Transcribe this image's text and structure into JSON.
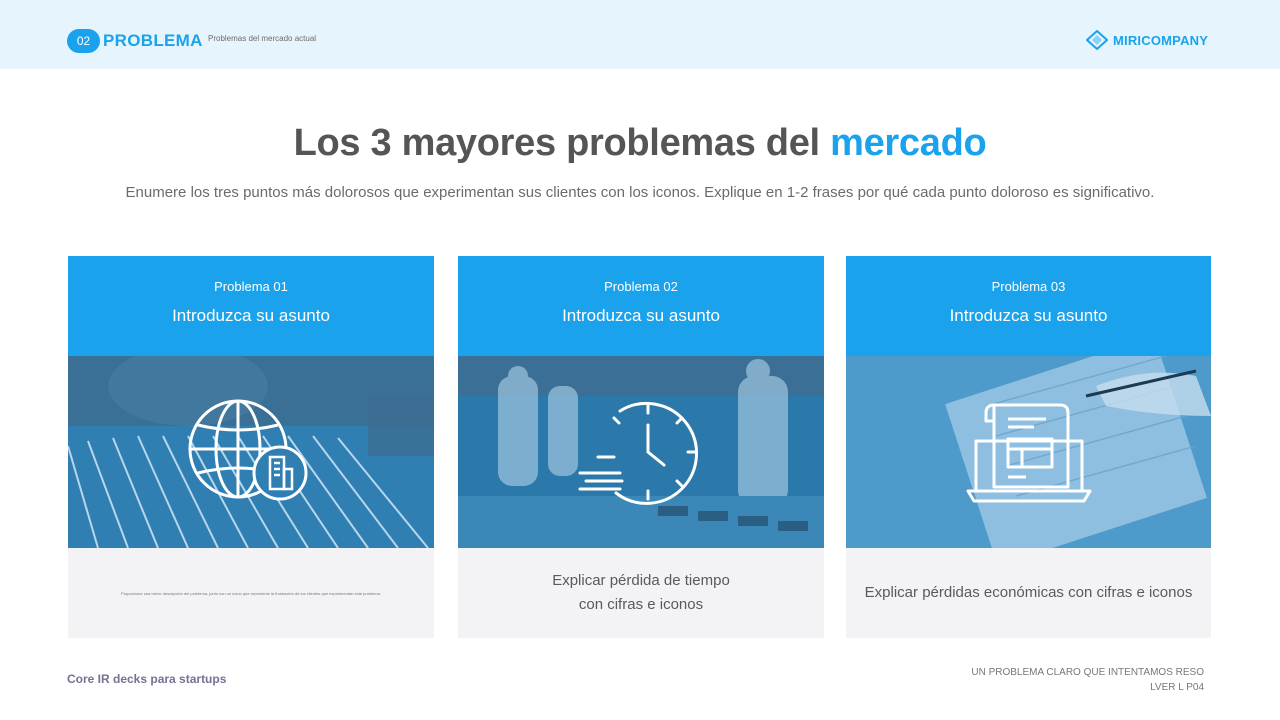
{
  "header": {
    "badge": "02",
    "section_title": "PROBLEMA",
    "section_subtitle": "Problemas del mercado actual",
    "brand": "MIRICOMPANY"
  },
  "main": {
    "title_part1": "Los 3 mayores problemas del",
    "title_accent": "mercado",
    "subtitle": "Enumere los tres puntos más dolorosos que experimentan sus clientes con los iconos. Explique en 1-2 frases por qué cada punto doloroso es significativo."
  },
  "cards": [
    {
      "number": "Problema 01",
      "title": "Introduzca su asunto",
      "icon": "globe-building-icon",
      "description": "Proporcione una breve descripción del problema, junto con un icono que represente la frustración de los clientes que experimentan este problema."
    },
    {
      "number": "Problema 02",
      "title": "Introduzca su asunto",
      "icon": "fast-clock-icon",
      "description_line1": "Explicar pérdida de tiempo",
      "description_line2": "con cifras e iconos"
    },
    {
      "number": "Problema 03",
      "title": "Introduzca su asunto",
      "icon": "document-laptop-icon",
      "description": "Explicar pérdidas económicas con cifras e iconos"
    }
  ],
  "footer": {
    "left": "Core IR decks para startups",
    "right_line1": "UN PROBLEMA CLARO QUE INTENTAMOS RESO",
    "right_line2": "LVER L P04"
  },
  "colors": {
    "accent": "#1aa3ec",
    "header_bg": "#e6f5fd",
    "card_body_bg": "#f3f3f6",
    "title_text": "#555555"
  }
}
